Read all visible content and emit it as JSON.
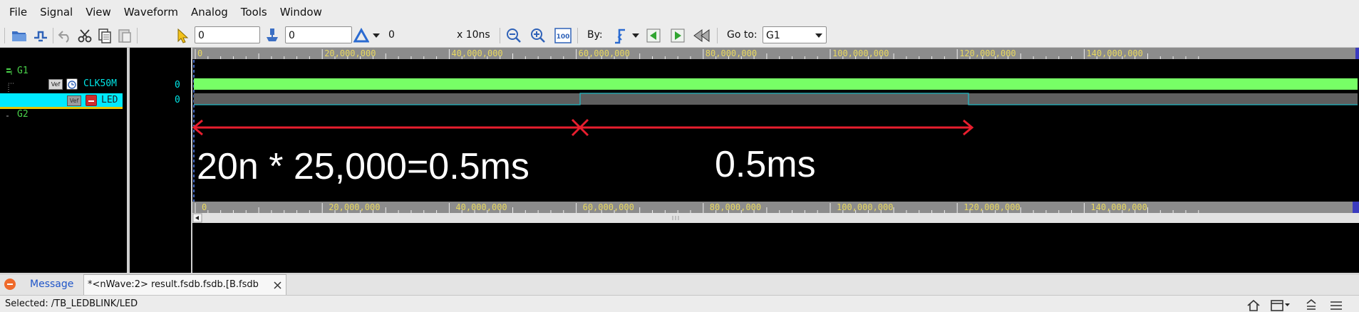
{
  "menu": [
    "File",
    "Signal",
    "View",
    "Waveform",
    "Analog",
    "Tools",
    "Window"
  ],
  "toolbar": {
    "cursor_value": "0",
    "marker_value": "0",
    "delta_value": "0",
    "time_unit": "x 10ns",
    "by_label": "By:",
    "goto_label": "Go to:",
    "goto_value": "G1",
    "zoom_100_label": "100"
  },
  "signals": {
    "group1": "G1",
    "clk": "CLK50M",
    "led": "LED",
    "group2": "G2",
    "clk_value": "0",
    "led_value": "0"
  },
  "ruler": {
    "labels": [
      "0",
      "20,000,000",
      "40,000,000",
      "60,000,000",
      "80,000,000",
      "100,000,000",
      "120,000,000",
      "140,000,000"
    ]
  },
  "annotation": {
    "left": "20n * 25,000=0.5ms",
    "right": "0.5ms"
  },
  "tabs": {
    "message": "Message",
    "wave": "*<nWave:2> result.fsdb.fsdb.[B.fsdb"
  },
  "status": {
    "selected": "Selected: /TB_LEDBLINK/LED"
  },
  "colors": {
    "clk": "#77ff66",
    "led_bg": "#5e5e5e",
    "led_edge": "#21b8c4",
    "selection": "#00eaff",
    "arrow": "#e81e2e",
    "ruler": "#8c8c8c",
    "ruler_text": "#e8d860",
    "group": "#4ad24a"
  }
}
